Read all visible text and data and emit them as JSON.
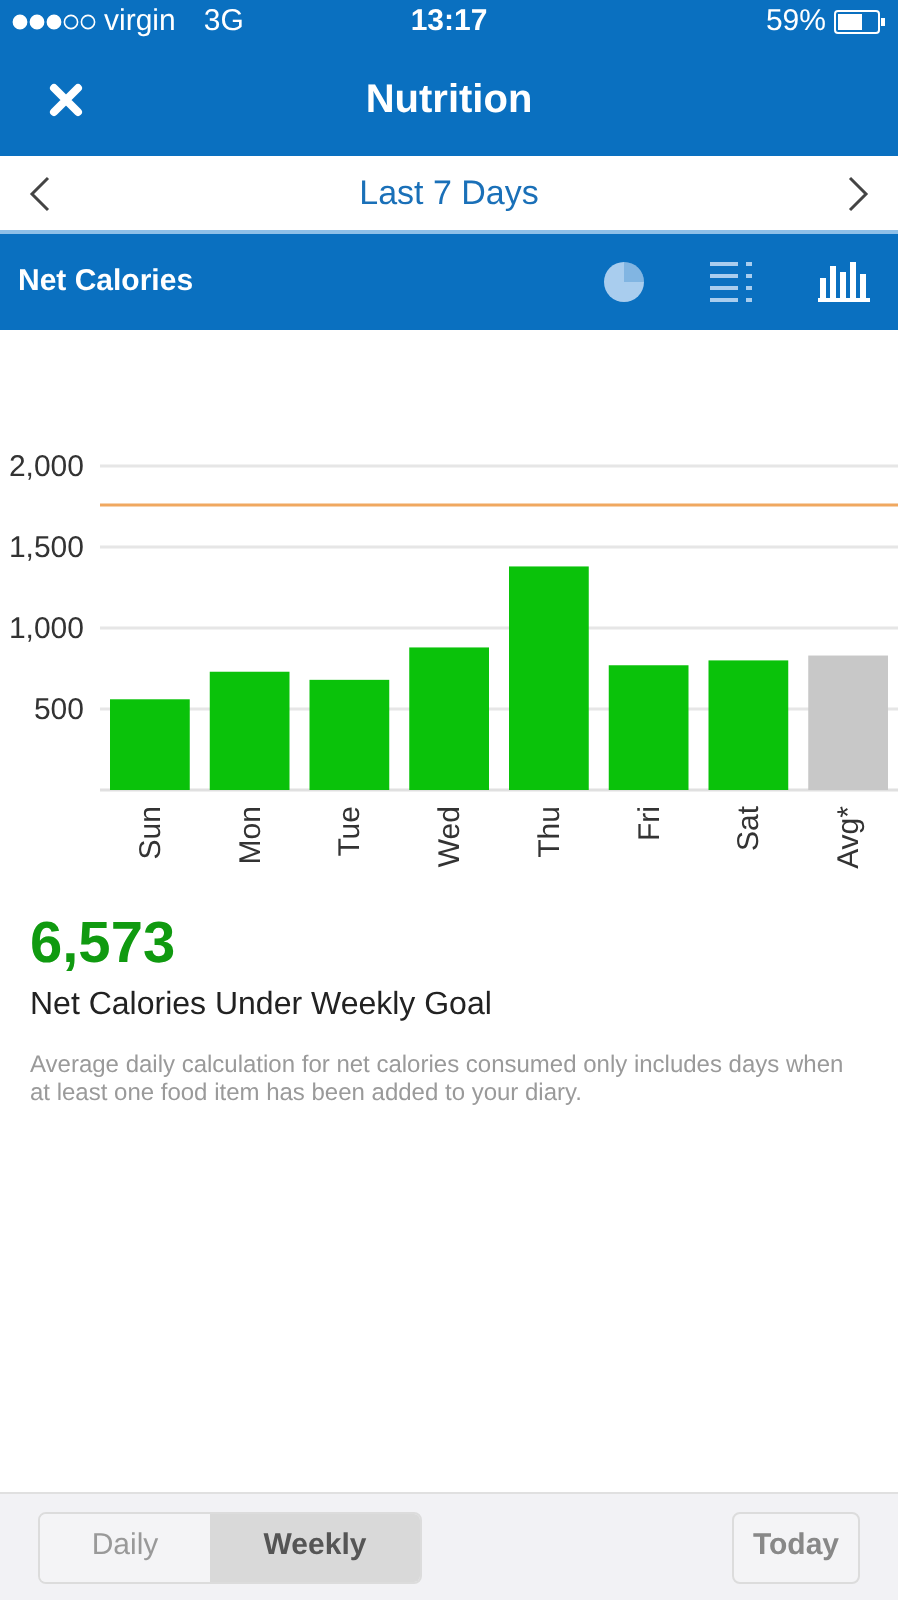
{
  "status_bar": {
    "carrier": "virgin",
    "network": "3G",
    "time": "13:17",
    "battery": "59%"
  },
  "nav": {
    "title": "Nutrition"
  },
  "date_bar": {
    "label": "Last 7 Days"
  },
  "section": {
    "title": "Net Calories",
    "views": [
      {
        "kind": "pie",
        "selected": false
      },
      {
        "kind": "list",
        "selected": false
      },
      {
        "kind": "bars",
        "selected": true
      }
    ]
  },
  "chart_data": {
    "type": "bar",
    "categories": [
      "Sun",
      "Mon",
      "Tue",
      "Wed",
      "Thu",
      "Fri",
      "Sat",
      "Avg*"
    ],
    "series": [
      {
        "color": "#0ac20a",
        "values": [
          560,
          730,
          680,
          880,
          1380,
          770,
          800,
          null
        ]
      },
      {
        "color": "#c8c8c8",
        "values": [
          null,
          null,
          null,
          null,
          null,
          null,
          null,
          830
        ]
      }
    ],
    "ylim": [
      0,
      2000
    ],
    "yticks": [
      500,
      {
        "value": 1000,
        "label": "1,000"
      },
      {
        "value": 1500,
        "label": "1,500"
      },
      {
        "value": 2000,
        "label": "2,000"
      }
    ],
    "grid": true,
    "ref_lines": [
      {
        "axis": "y",
        "value": 1760,
        "color": "#f0a860"
      }
    ]
  },
  "summary": {
    "value": "6,573",
    "label": "Net Calories Under Weekly Goal",
    "note": "Average daily calculation for net calories consumed only includes days when at least one food item has been added to your diary."
  },
  "bottom_bar": {
    "tabs": [
      {
        "label": "Daily",
        "selected": false
      },
      {
        "label": "Weekly",
        "selected": true
      }
    ],
    "today": "Today"
  }
}
